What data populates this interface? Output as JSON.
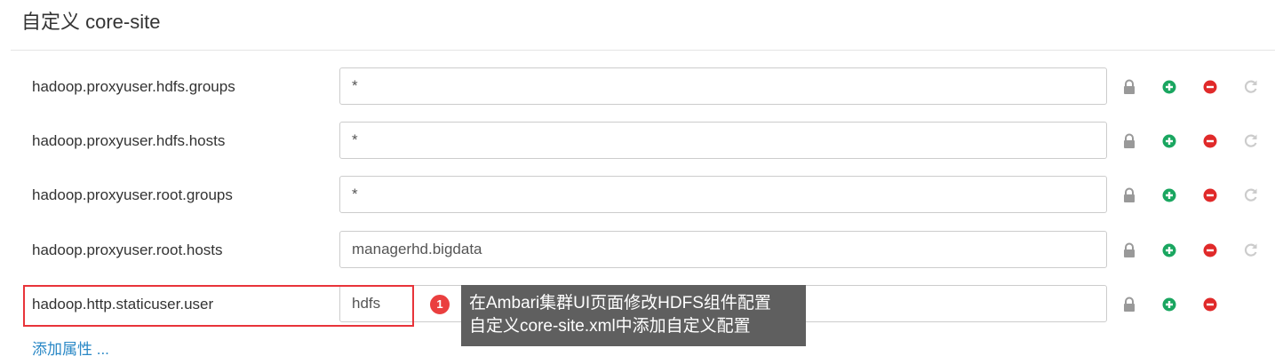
{
  "section": {
    "title": "自定义 core-site"
  },
  "properties": [
    {
      "key": "hadoop.proxyuser.hdfs.groups",
      "value": "*"
    },
    {
      "key": "hadoop.proxyuser.hdfs.hosts",
      "value": "*"
    },
    {
      "key": "hadoop.proxyuser.root.groups",
      "value": "*"
    },
    {
      "key": "hadoop.proxyuser.root.hosts",
      "value": "managerhd.bigdata"
    },
    {
      "key": "hadoop.http.staticuser.user",
      "value": "hdfs"
    }
  ],
  "annotation": {
    "step": "1",
    "line1": "在Ambari集群UI页面修改HDFS组件配置",
    "line2": "自定义core-site.xml中添加自定义配置"
  },
  "add_property": {
    "label": "添加属性 ..."
  },
  "icons": {
    "lock": "lock-icon",
    "add": "plus-circle-icon",
    "remove": "minus-circle-icon",
    "undo": "undo-icon"
  },
  "colors": {
    "add": "#1aa660",
    "remove": "#e02a2a",
    "lock": "#999999",
    "undo": "#cccccc",
    "highlight": "#e8343a",
    "link": "#2a88c6",
    "tooltip_bg": "#5f5f5f"
  }
}
